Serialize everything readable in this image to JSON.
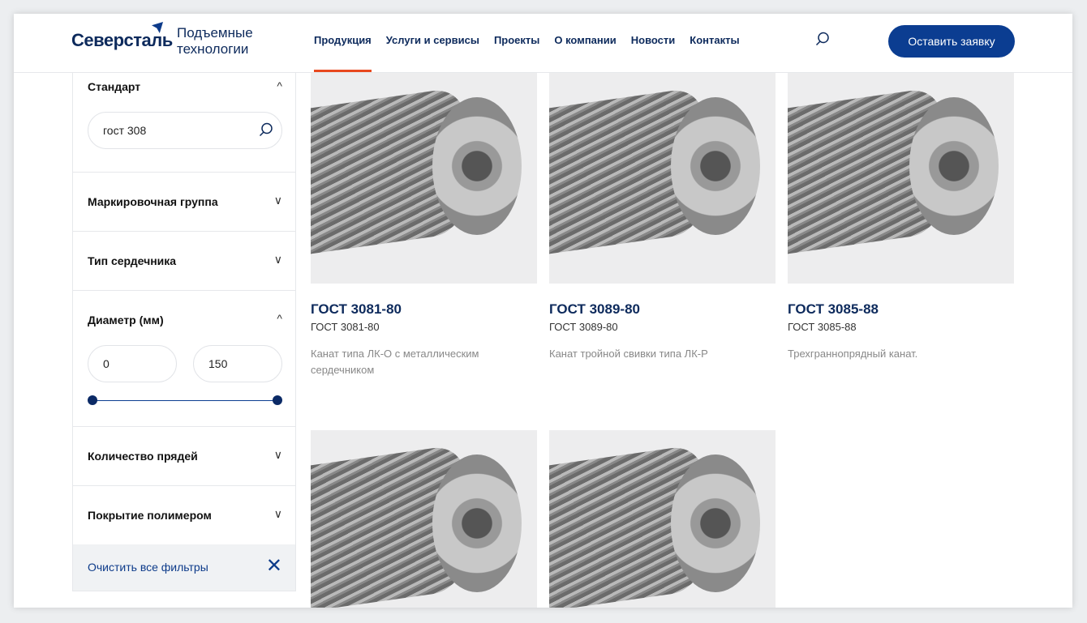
{
  "header": {
    "logo": "Северсталь",
    "subtitle_line1": "Подъемные",
    "subtitle_line2": "технологии",
    "nav": [
      "Продукция",
      "Услуги и сервисы",
      "Проекты",
      "О компании",
      "Новости",
      "Контакты"
    ],
    "cta": "Оставить заявку"
  },
  "filters": {
    "standard": {
      "title": "Стандарт",
      "value": "гост 308"
    },
    "marking": "Маркировочная группа",
    "core": "Тип сердечника",
    "diameter": {
      "title": "Диаметр (мм)",
      "min": "0",
      "max": "150"
    },
    "strands": "Количество прядей",
    "polymer": "Покрытие полимером",
    "clear": "Очистить все фильтры"
  },
  "products": [
    {
      "title": "ГОСТ 3081-80",
      "subtitle": "ГОСТ 3081-80",
      "desc": "Канат типа ЛК-О с металлическим сердечником"
    },
    {
      "title": "ГОСТ 3089-80",
      "subtitle": "ГОСТ 3089-80",
      "desc": "Канат тройной свивки типа ЛК-Р"
    },
    {
      "title": "ГОСТ 3085-88",
      "subtitle": "ГОСТ 3085-88",
      "desc": "Трехграннопрядный канат."
    }
  ]
}
